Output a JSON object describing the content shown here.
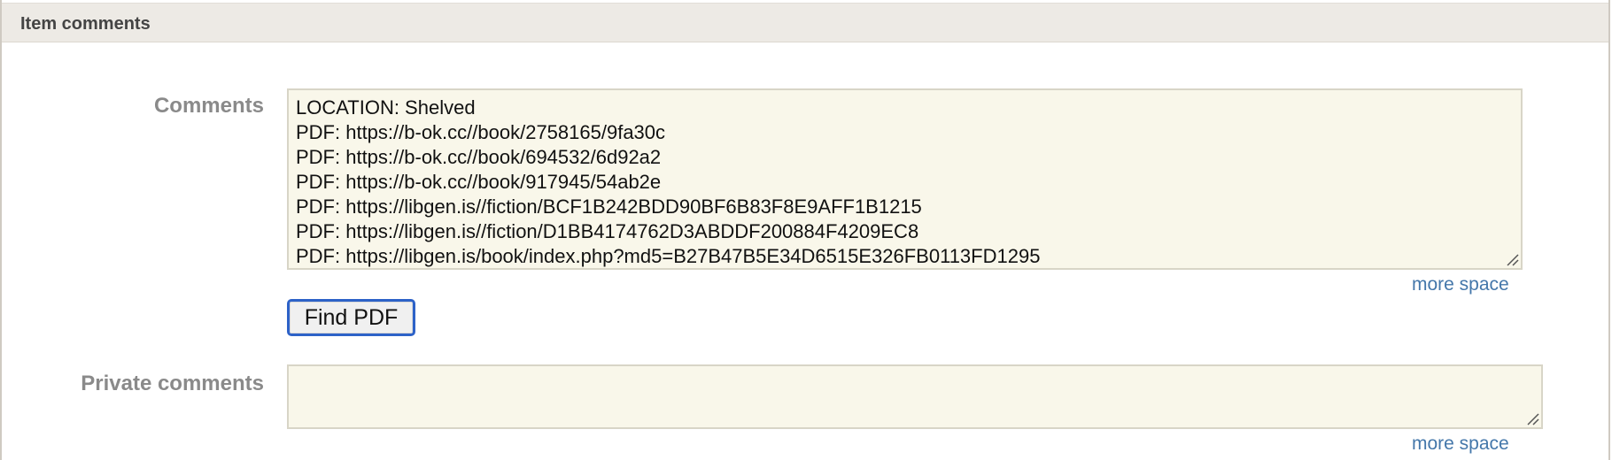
{
  "section": {
    "title": "Item comments"
  },
  "comments": {
    "label": "Comments",
    "lines": [
      "LOCATION: Shelved",
      "PDF: https://b-ok.cc//book/2758165/9fa30c",
      "PDF: https://b-ok.cc//book/694532/6d92a2",
      "PDF: https://b-ok.cc//book/917945/54ab2e",
      "PDF: https://libgen.is//fiction/BCF1B242BDD90BF6B83F8E9AFF1B1215",
      "PDF: https://libgen.is//fiction/D1BB4174762D3ABDDF200884F4209EC8",
      "PDF: https://libgen.is/book/index.php?md5=B27B47B5E34D6515E326FB0113FD1295"
    ],
    "more_space_label": "more space"
  },
  "find_pdf": {
    "label": "Find PDF"
  },
  "private_comments": {
    "label": "Private comments",
    "value": "",
    "more_space_label": "more space"
  },
  "colors": {
    "header_bg": "#edeae5",
    "textarea_bg": "#f9f7ea",
    "link": "#4477aa",
    "button_focus_border": "#2d62c8",
    "label_text": "#8a8a8a"
  }
}
